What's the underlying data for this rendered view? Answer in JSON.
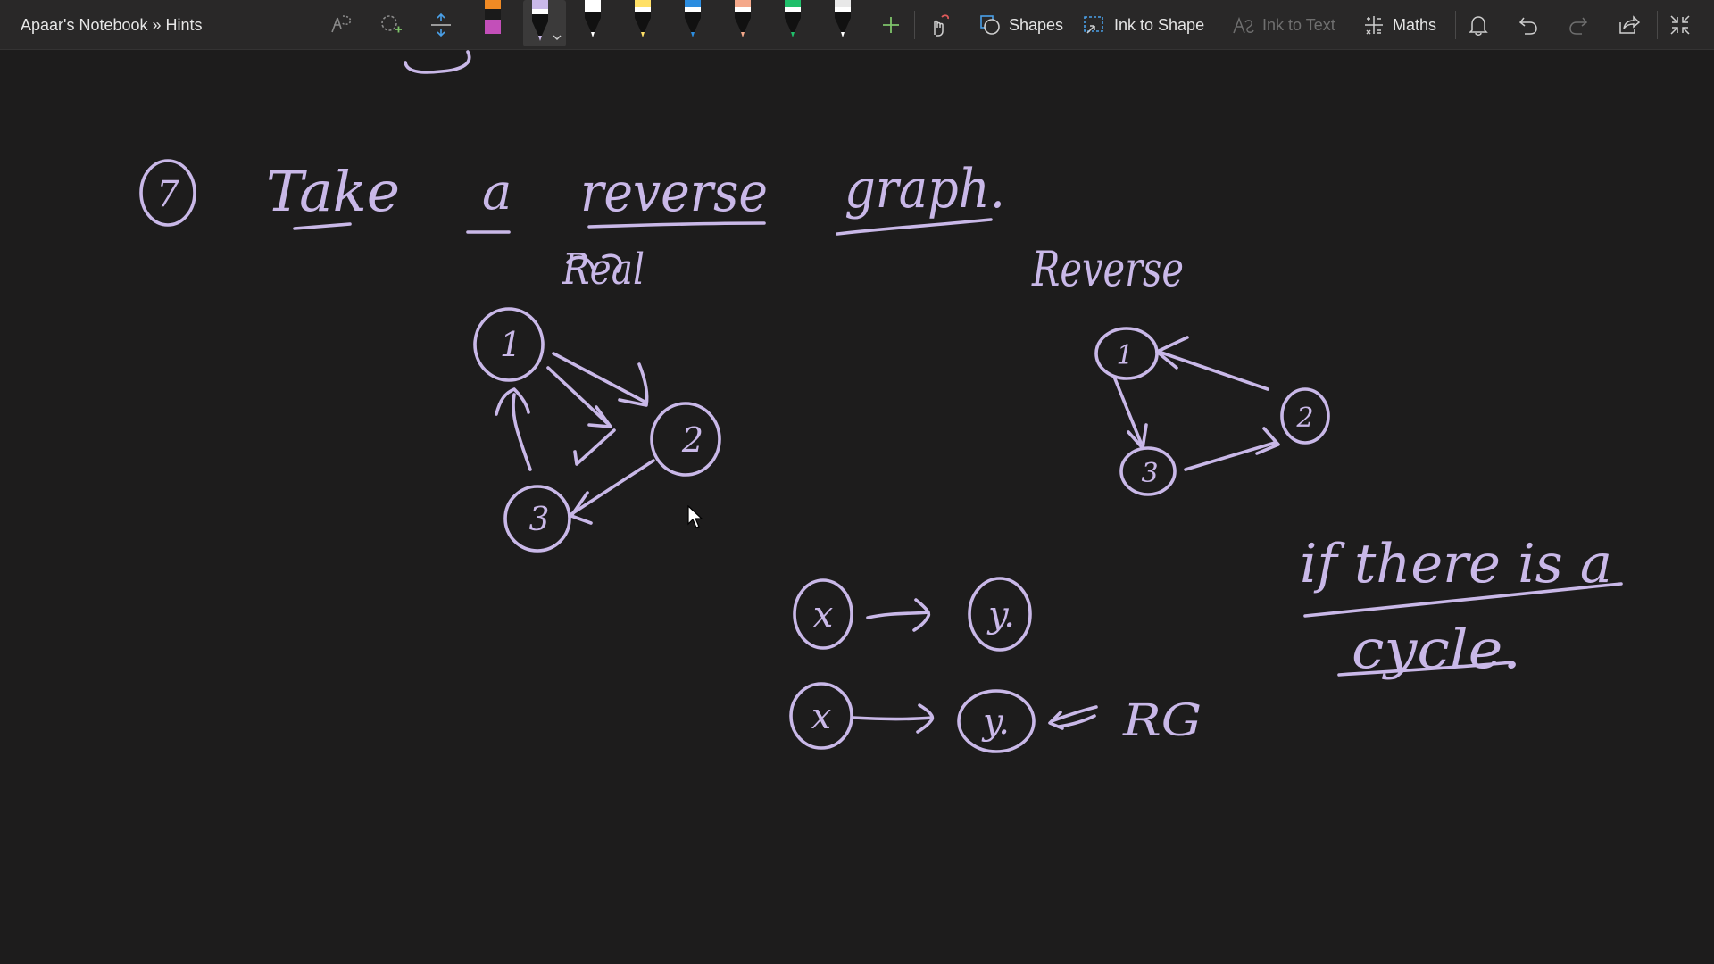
{
  "window": {
    "breadcrumb": "Apaar's Notebook » Hints"
  },
  "toolbar": {
    "tools": [
      {
        "name": "lasso-select-icon"
      },
      {
        "name": "eraser-icon"
      },
      {
        "name": "add-space-icon"
      }
    ],
    "pens": [
      {
        "name": "pen-orange-magenta",
        "tip": "#c34fb9",
        "band": "#f08a24",
        "selected": false
      },
      {
        "name": "pen-lavender",
        "tip": "#c9b8e8",
        "band": "#c9b8e8",
        "selected": true
      },
      {
        "name": "pen-white",
        "tip": "#ffffff",
        "band": "#ffffff",
        "selected": false
      },
      {
        "name": "pen-yellow",
        "tip": "#ffe066",
        "band": "#ffe066",
        "selected": false
      },
      {
        "name": "pen-blue",
        "tip": "#2b8de0",
        "band": "#2b8de0",
        "selected": false
      },
      {
        "name": "pen-peach",
        "tip": "#f4a88a",
        "band": "#f4a88a",
        "selected": false
      },
      {
        "name": "pen-green",
        "tip": "#1fbf6a",
        "band": "#1fbf6a",
        "selected": false
      },
      {
        "name": "pen-black",
        "tip": "#ffffff",
        "band": "#e8e8e8",
        "selected": false
      }
    ],
    "shapes_label": "Shapes",
    "ink_to_shape_label": "Ink to Shape",
    "ink_to_text_label": "Ink to Text",
    "maths_label": "Maths",
    "accent_color": "#7ec46a",
    "ink_color": "#c9b8e8"
  },
  "canvas": {
    "ink_labels": {
      "step_number": "7",
      "heading": {
        "take": "Take",
        "a": "a",
        "reverse": "reverse",
        "graph": "graph."
      },
      "real_label": "Real",
      "reverse_label": "Reverse",
      "real_graph_nodes": [
        "1",
        "2",
        "3"
      ],
      "reverse_graph_nodes": [
        "1",
        "2",
        "3"
      ],
      "edge_row1": {
        "from": "x",
        "to": "y."
      },
      "edge_row2": {
        "from": "x",
        "to": "y.",
        "tag": "RG"
      },
      "note_line1": "if there is a",
      "note_line2": "cycle."
    }
  }
}
